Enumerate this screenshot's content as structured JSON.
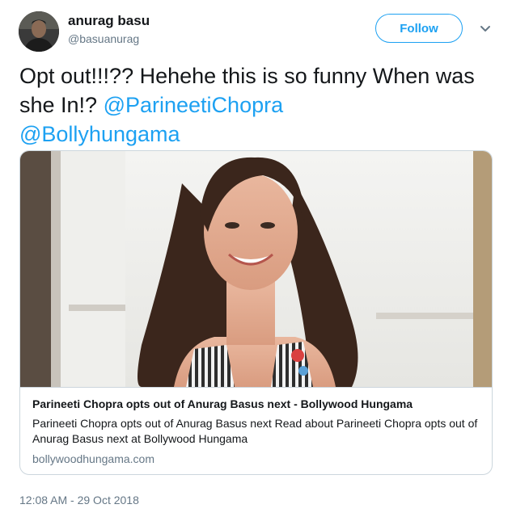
{
  "author": {
    "name": "anurag basu",
    "handle": "@basuanurag"
  },
  "follow_label": "Follow",
  "tweet": {
    "text": "Opt out!!!?? Hehehe this is so funny When was she In!? ",
    "mentions": [
      "@ParineetiChopra",
      "@Bollyhungama"
    ]
  },
  "card": {
    "title": "Parineeti Chopra opts out of Anurag Basus next - Bollywood Hungama",
    "description": "Parineeti Chopra opts out of Anurag Basus next Read about Parineeti Chopra opts out of Anurag Basus next at Bollywood Hungama",
    "domain": "bollywoodhungama.com"
  },
  "timestamp": "12:08 AM - 29 Oct 2018",
  "colors": {
    "accent": "#1da1f2",
    "text": "#14171a",
    "secondary": "#657786",
    "border": "#ccd6dd"
  },
  "icons": {
    "menu": "chevron-down-icon"
  }
}
